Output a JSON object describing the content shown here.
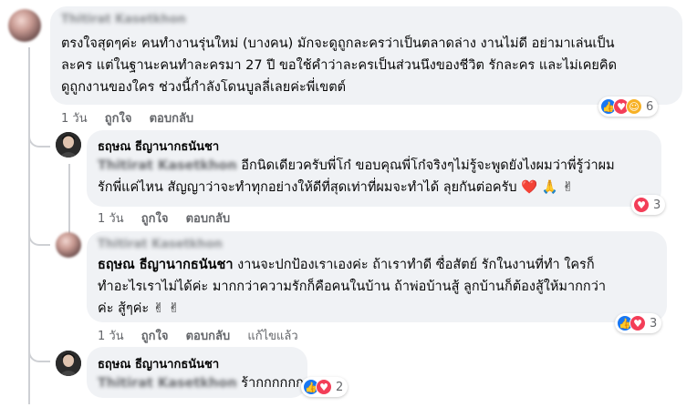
{
  "comments": [
    {
      "name": "Thitirat Kasetkhon",
      "lines": [
        "ตรงใจสุดๆค่ะ คนทำงานรุ่นใหม่ (บางคน) มักจะดูถูกละครว่าเป็นตลาดล่าง งานไม่ดี อย่ามาเล่นเป็น",
        "ละคร แต่ในฐานะคนทำละครมา 27 ปี ขอใช้คำว่าละครเป็นส่วนนึงของชีวิต รักละคร และไม่เคยคิด",
        "ดูถูกงานของใคร ช่วงนี้กำลังโดนบูลลี่เลยค่ะพี่เขตต์"
      ],
      "time": "1 วัน",
      "like_label": "ถูกใจ",
      "reply_label": "ตอบกลับ",
      "reactions": [
        "like",
        "love",
        "care"
      ],
      "reaction_count": "6"
    },
    {
      "name": "ธฤษณ ธีญานากธนันชา",
      "tag": "Thitirat Kasetkhon",
      "lines": [
        "อีกนิดเดียวครับพี่โก๋ ขอบคุณพี่โก๋จริงๆไม่รู้จะพูดยังไงผมว่าพี่รู้ว่าผม",
        "รักพี่แค่ไหน สัญญาว่าจะทำทุกอย่างให้ดีที่สุดเท่าที่ผมจะทำได้ ลุยกันต่อครับ"
      ],
      "emojis": "❤️ 🙏 ✌",
      "time": "1 วัน",
      "like_label": "ถูกใจ",
      "reply_label": "ตอบกลับ",
      "reactions": [
        "love"
      ],
      "reaction_count": "3"
    },
    {
      "name": "Thitirat Kasetkhon",
      "tag": "ธฤษณ ธีญานากธนันชา",
      "lines": [
        "งานจะปกป้องเราเองค่ะ ถ้าเราทำดี ซื่อสัตย์ รักในงานที่ทำ ใครก็",
        "ทำอะไรเราไม่ได้ค่ะ มากกว่าความรักก็คือคนในบ้าน ถ้าพ่อบ้านสู้ ลูกบ้านก็ต้องสู้ให้มากกว่า",
        "ค่ะ สู้ๆค่ะ"
      ],
      "emojis": "✌ ✌",
      "time": "1 วัน",
      "like_label": "ถูกใจ",
      "reply_label": "ตอบกลับ",
      "edited_label": "แก้ไขแล้ว",
      "reactions": [
        "like",
        "love"
      ],
      "reaction_count": "3"
    },
    {
      "name": "ธฤษณ ธีญานากธนันชา",
      "tag": "Thitirat Kasetkhon",
      "text": "ร้ากกกกกก",
      "reactions": [
        "like",
        "love"
      ],
      "reaction_count": "2"
    }
  ]
}
